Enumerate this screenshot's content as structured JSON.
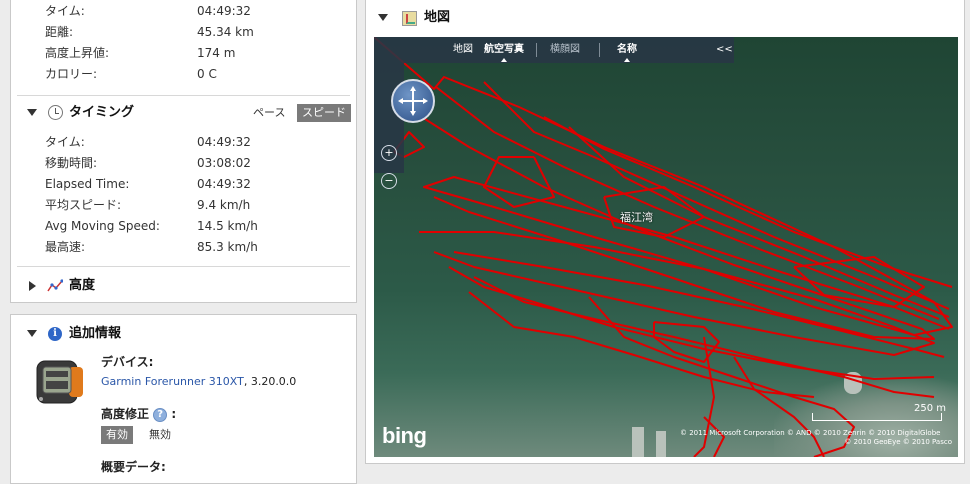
{
  "summary_rows": [
    {
      "label": "タイム:",
      "value": "04:49:32"
    },
    {
      "label": "距離:",
      "value": "45.34 km"
    },
    {
      "label": "高度上昇値:",
      "value": "174 m"
    },
    {
      "label": "カロリー:",
      "value": "0 C"
    }
  ],
  "timing": {
    "title": "タイミング",
    "pace_label": "ペース",
    "speed_label": "スピード",
    "rows": [
      {
        "label": "タイム:",
        "value": "04:49:32"
      },
      {
        "label": "移動時間:",
        "value": "03:08:02"
      },
      {
        "label": "Elapsed Time:",
        "value": "04:49:32"
      },
      {
        "label": "平均スピード:",
        "value": "9.4 km/h"
      },
      {
        "label": "Avg Moving Speed:",
        "value": "14.5 km/h"
      },
      {
        "label": "最高速:",
        "value": "85.3 km/h"
      }
    ]
  },
  "elevation": {
    "title": "高度"
  },
  "additional": {
    "title": "追加情報",
    "device_label": "デバイス:",
    "device_name": "Garmin Forerunner 310XT",
    "device_version": ", 3.20.0.0",
    "elev_corr_label": "高度修正",
    "elev_corr_colon": ":",
    "enabled_label": "有効",
    "disabled_label": "無効",
    "summary_data_label": "概要データ:"
  },
  "map": {
    "title": "地図",
    "toolbar": {
      "road": "地図",
      "aerial": "航空写真",
      "birdseye": "横顔図",
      "labels": "名称",
      "collapse": "<<"
    },
    "place_label": "福江湾",
    "bing": "bing",
    "copyright_line1": "© 2011 Microsoft Corporation   © AND   © 2010 Zenrin   © 2010 DigitalGlobe",
    "copyright_line2": "© 2010 GeoEye   © 2010 Pasco",
    "scale_label": "250 m"
  },
  "colors": {
    "track": "#e00000",
    "toggle_active": "#7a7a7a",
    "link": "#2b57a8"
  }
}
